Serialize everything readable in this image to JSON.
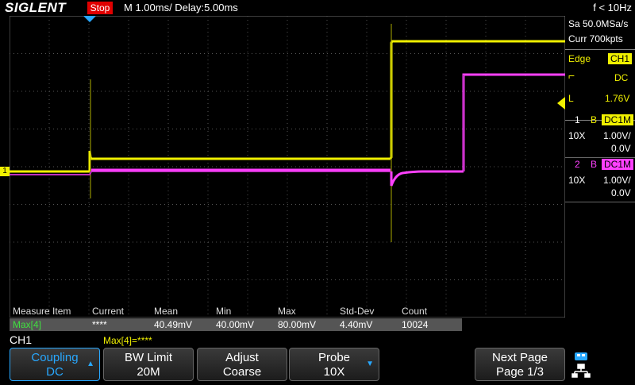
{
  "header": {
    "brand": "SIGLENT",
    "run_state": "Stop",
    "timebase": "M 1.00ms/ Delay:5.00ms",
    "trigger_freq": "f < 10Hz"
  },
  "acquisition": {
    "sample_rate": "Sa 50.0MSa/s",
    "memory_depth": "Curr 700kpts"
  },
  "trigger": {
    "mode": "Edge",
    "source": "CH1",
    "coupling": "DC",
    "level_label": "L",
    "level": "1.76V"
  },
  "channels": [
    {
      "num": "1",
      "bw": "B",
      "coupling": "DC1M",
      "probe": "10X",
      "scale": "1.00V/",
      "offset": "0.0V",
      "color": "#f0f000"
    },
    {
      "num": "2",
      "bw": "B",
      "coupling": "DC1M",
      "probe": "10X",
      "scale": "1.00V/",
      "offset": "0.0V",
      "color": "#ff40ff"
    }
  ],
  "measurement": {
    "headers": [
      "Measure Item",
      "Current",
      "Mean",
      "Min",
      "Max",
      "Std-Dev",
      "Count"
    ],
    "row": [
      "Max[4]",
      "****",
      "40.49mV",
      "40.00mV",
      "80.00mV",
      "4.40mV",
      "10024"
    ]
  },
  "status": {
    "channel": "CH1",
    "note": "Max[4]=****"
  },
  "softkeys": [
    {
      "line1": "Coupling",
      "line2": "DC",
      "selected": true,
      "arrow": "up"
    },
    {
      "line1": "BW Limit",
      "line2": "20M",
      "selected": false,
      "arrow": ""
    },
    {
      "line1": "Adjust",
      "line2": "Coarse",
      "selected": false,
      "arrow": ""
    },
    {
      "line1": "Probe",
      "line2": "10X",
      "selected": false,
      "arrow": "down"
    },
    {
      "line1": "Next Page",
      "line2": "Page 1/3",
      "selected": false,
      "arrow": ""
    }
  ],
  "markers": {
    "ch1_ground": "1"
  },
  "icons": {
    "usb": "usb-icon",
    "network": "network-icon",
    "trigger_edge": "rising-edge-icon"
  }
}
